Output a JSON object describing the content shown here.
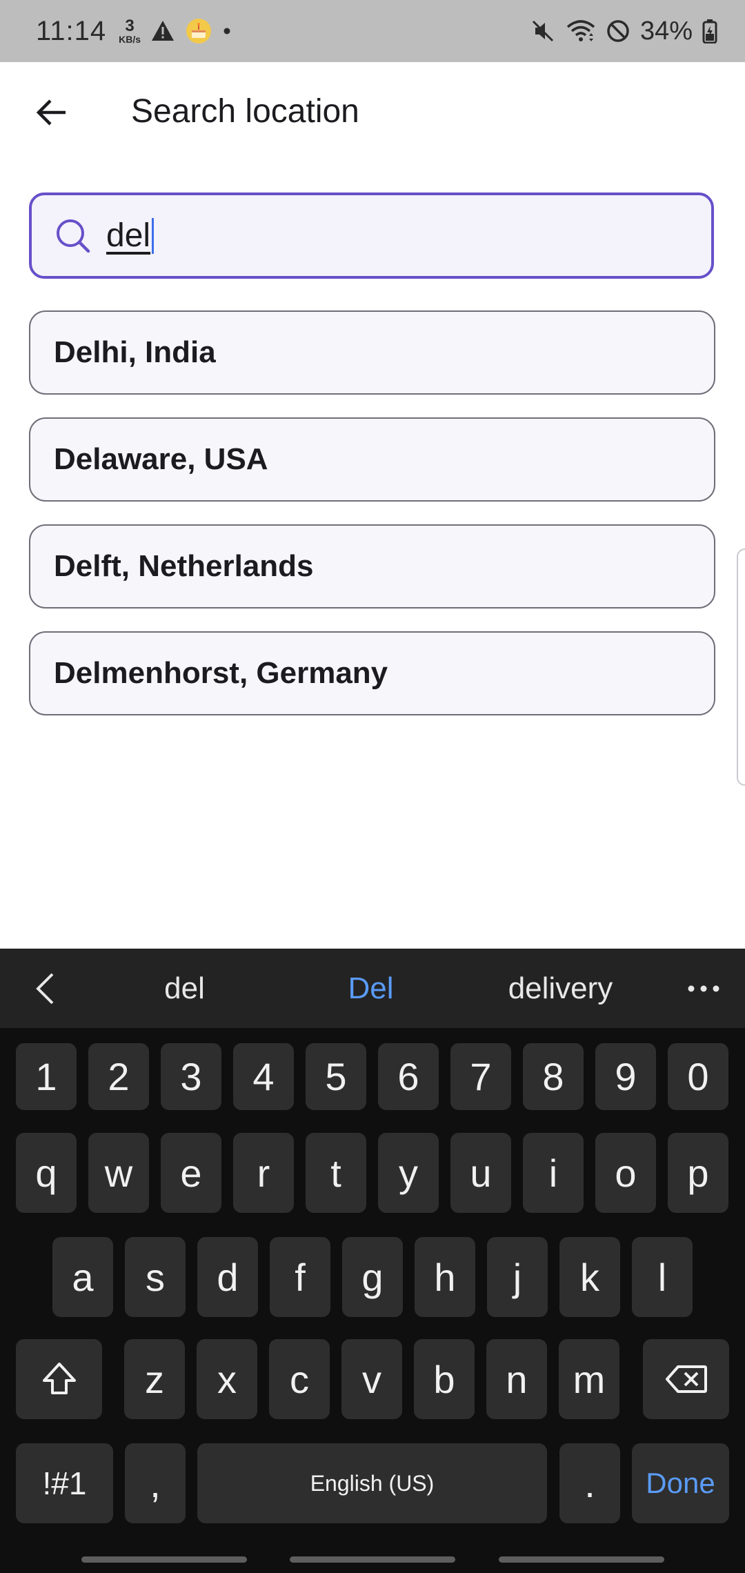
{
  "status_bar": {
    "time": "11:14",
    "net_speed_value": "3",
    "net_speed_unit": "KB/s",
    "battery": "34%",
    "icons": [
      "warning-icon",
      "cake-notification-icon",
      "dot-icon",
      "mute-icon",
      "wifi-icon",
      "do-not-disturb-icon",
      "battery-icon"
    ]
  },
  "app_bar": {
    "title": "Search location",
    "back_icon": "arrow-left-icon"
  },
  "search": {
    "value": "del",
    "icon": "search-icon",
    "accent_color": "#6750c9"
  },
  "results": [
    {
      "label": "Delhi, India"
    },
    {
      "label": "Delaware, USA"
    },
    {
      "label": "Delft, Netherlands"
    },
    {
      "label": "Delmenhorst, Germany"
    }
  ],
  "keyboard": {
    "suggestions": [
      "del",
      "Del",
      "delivery"
    ],
    "highlight_color": "#5a9bf6",
    "number_row": [
      "1",
      "2",
      "3",
      "4",
      "5",
      "6",
      "7",
      "8",
      "9",
      "0"
    ],
    "row1": [
      "q",
      "w",
      "e",
      "r",
      "t",
      "y",
      "u",
      "i",
      "o",
      "p"
    ],
    "row2": [
      "a",
      "s",
      "d",
      "f",
      "g",
      "h",
      "j",
      "k",
      "l"
    ],
    "row3": [
      "z",
      "x",
      "c",
      "v",
      "b",
      "n",
      "m"
    ],
    "symbols_label": "!#1",
    "comma_label": ",",
    "space_label": "English (US)",
    "period_label": ".",
    "done_label": "Done"
  }
}
